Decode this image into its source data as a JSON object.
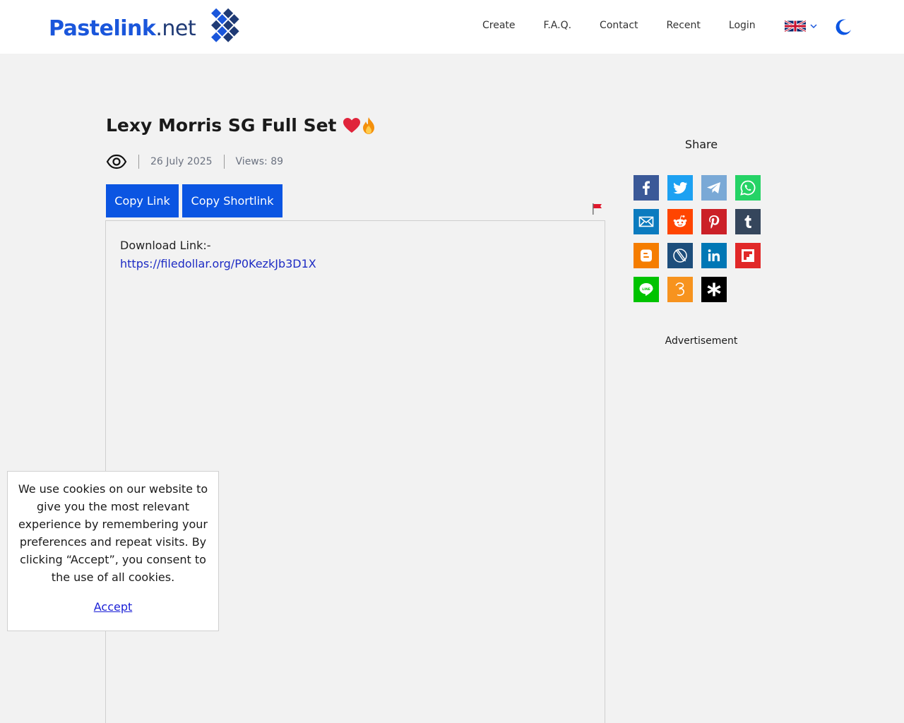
{
  "header": {
    "logo_main": "Pastelink",
    "logo_tld": ".net",
    "nav": [
      "Create",
      "F.A.Q.",
      "Contact",
      "Recent",
      "Login"
    ],
    "language_icon": "uk-flag-icon",
    "theme_icon": "moon-icon",
    "brand_color": "#0b55e2"
  },
  "paste": {
    "title": "Lexy Morris SG Full Set",
    "title_emoji": "heart-fire",
    "date": "26 July 2025",
    "views": "Views: 89",
    "copy_link_label": "Copy Link",
    "copy_shortlink_label": "Copy Shortlink",
    "content_line1": "Download Link:-",
    "content_link": "https://filedollar.org/P0KezkJb3D1X"
  },
  "sidebar": {
    "share_title": "Share",
    "share_items": [
      {
        "name": "facebook-icon",
        "color": "#3b5998"
      },
      {
        "name": "twitter-icon",
        "color": "#1da1f2"
      },
      {
        "name": "telegram-icon",
        "color": "#54a9eb"
      },
      {
        "name": "whatsapp-icon",
        "color": "#25d366"
      },
      {
        "name": "email-icon",
        "color": "#0b7bbf"
      },
      {
        "name": "reddit-icon",
        "color": "#ff4500"
      },
      {
        "name": "pinterest-icon",
        "color": "#cb2027"
      },
      {
        "name": "tumblr-icon",
        "color": "#35465c"
      },
      {
        "name": "blogger-icon",
        "color": "#f57d00"
      },
      {
        "name": "livejournal-icon",
        "color": "#00659e"
      },
      {
        "name": "linkedin-icon",
        "color": "#0077b5"
      },
      {
        "name": "flipboard-icon",
        "color": "#e12828"
      },
      {
        "name": "line-icon",
        "color": "#00c300"
      },
      {
        "name": "ok-icon",
        "color": "#f7931e"
      },
      {
        "name": "asterisk-icon",
        "color": "#000000"
      }
    ],
    "advertisement": "Advertisement"
  },
  "cookie": {
    "text": "We use cookies on our website to give you the most relevant experience by remembering your preferences and repeat visits. By clicking “Accept”, you consent to the use of all cookies.",
    "accept_label": "Accept"
  }
}
